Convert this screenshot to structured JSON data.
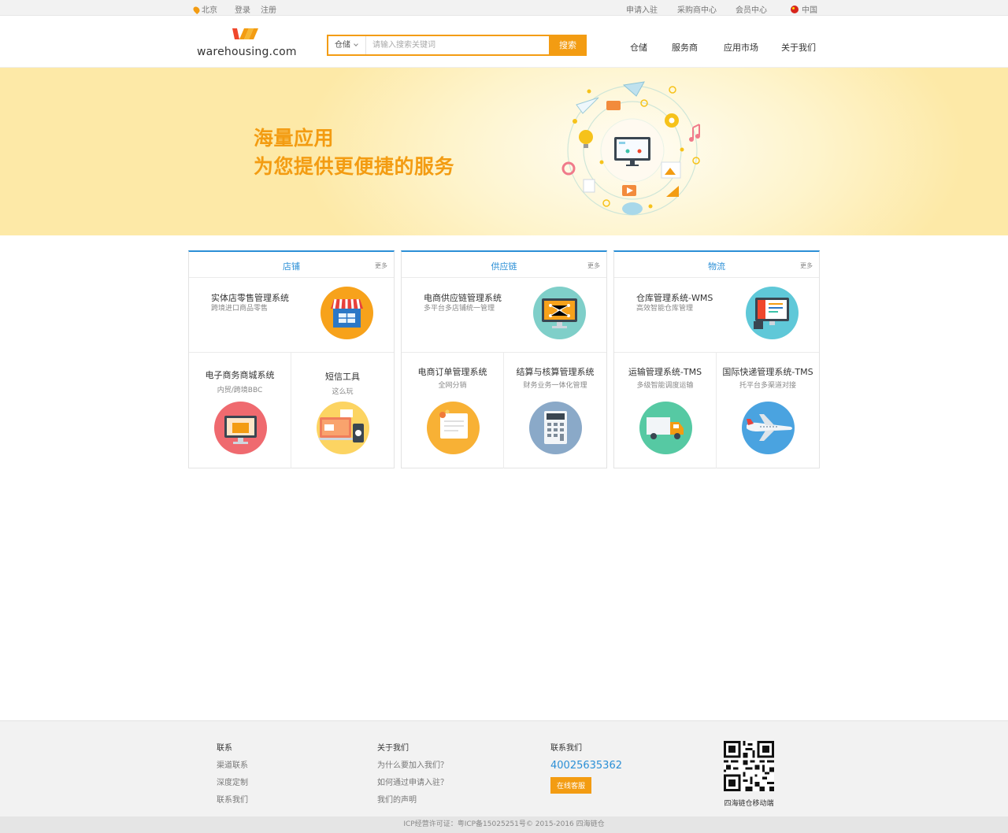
{
  "topbar": {
    "city": "北京",
    "login": "登录",
    "register": "注册",
    "apply": "申请入驻",
    "buyer_center": "采购商中心",
    "member_center": "会员中心",
    "region": "中国"
  },
  "header": {
    "logo_text": "warehousing.com",
    "search_category": "仓储",
    "search_placeholder": "请输入搜索关键词",
    "search_button": "搜索",
    "nav": [
      "仓储",
      "服务商",
      "应用市场",
      "关于我们"
    ]
  },
  "banner": {
    "line1": "海量应用",
    "line2": "为您提供更便捷的服务"
  },
  "panels": [
    {
      "title": "店铺",
      "more": "更多",
      "feature": {
        "title": "实体店零售管理系统",
        "sub": "跨境进口商品零售",
        "icon": "storefront-icon"
      },
      "cells": [
        {
          "title": "电子商务商城系统",
          "sub": "内贸/跨境BBC",
          "icon": "monitor-shop-icon"
        },
        {
          "title": "短信工具",
          "sub": "这么玩",
          "icon": "devices-message-icon"
        }
      ]
    },
    {
      "title": "供应链",
      "more": "更多",
      "feature": {
        "title": "电商供应链管理系统",
        "sub": "多平台多店铺统一管理",
        "icon": "network-monitor-icon"
      },
      "cells": [
        {
          "title": "电商订单管理系统",
          "sub": "全网分销",
          "icon": "order-document-icon"
        },
        {
          "title": "结算与核算管理系统",
          "sub": "财务业务一体化管理",
          "icon": "calculator-icon"
        }
      ]
    },
    {
      "title": "物流",
      "more": "更多",
      "feature": {
        "title": "仓库管理系统-WMS",
        "sub": "高效智能仓库管理",
        "icon": "warehouse-dashboard-icon"
      },
      "cells": [
        {
          "title": "运输管理系统-TMS",
          "sub": "多级智能调度运输",
          "icon": "truck-icon"
        },
        {
          "title": "国际快递管理系统-TMS",
          "sub": "托平台多渠道对接",
          "icon": "airplane-icon"
        }
      ]
    }
  ],
  "footer": {
    "col1": {
      "head": "联系",
      "links": [
        "渠道联系",
        "深度定制",
        "联系我们"
      ]
    },
    "col2": {
      "head": "关于我们",
      "links": [
        "为什么要加入我们？",
        "如何通过申请入驻？",
        "我们的声明"
      ]
    },
    "col3": {
      "head": "联系我们",
      "phone": "40025635362",
      "button": "在线客服"
    },
    "qr_caption": "四海链仓移动端",
    "copyright": "ICP经营许可证：粤ICP备15025251号© 2015-2016 四海链仓"
  },
  "colors": {
    "accent": "#f39c12",
    "link_blue": "#2b8fd6"
  }
}
